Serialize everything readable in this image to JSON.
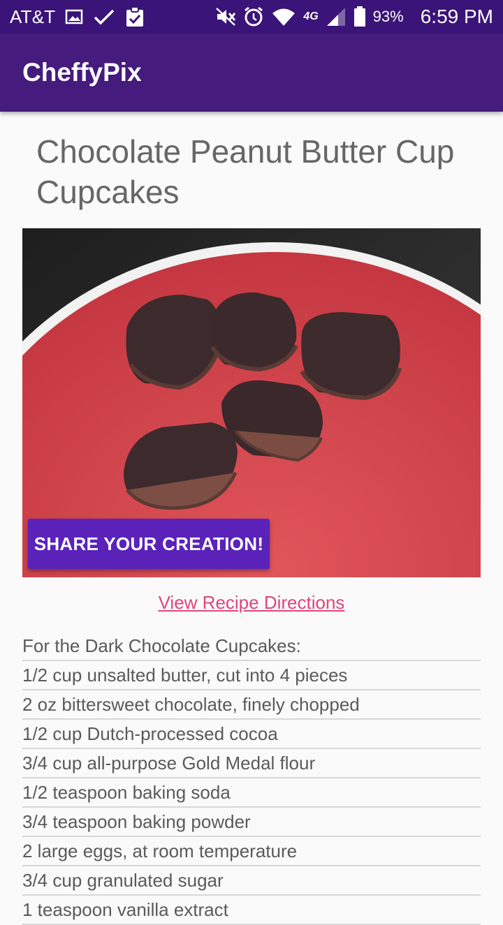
{
  "status_bar": {
    "carrier": "AT&T",
    "network": "4G",
    "battery": "93%",
    "time": "6:59 PM",
    "icons": [
      "gallery-icon",
      "check-icon",
      "clipboard-check-icon",
      "mute-icon",
      "alarm-icon",
      "wifi-icon",
      "signal-icon",
      "battery-icon"
    ]
  },
  "app": {
    "title": "CheffyPix",
    "bar_color": "#451b7e"
  },
  "recipe": {
    "title": "Chocolate Peanut Butter Cup Cupcakes",
    "share_label": "SHARE YOUR CREATION!",
    "directions_link": "View Recipe Directions",
    "ingredients": [
      "For the Dark Chocolate Cupcakes:",
      "1/2 cup unsalted butter, cut into 4 pieces",
      "2 oz bittersweet chocolate, finely chopped",
      "1/2 cup Dutch-processed cocoa",
      "3/4 cup all-purpose Gold Medal flour",
      "1/2 teaspoon baking soda",
      "3/4 teaspoon baking powder",
      "2 large eggs, at room temperature",
      "3/4 cup granulated sugar",
      "1 teaspoon vanilla extract"
    ]
  },
  "colors": {
    "accent": "#5b22ba",
    "link": "#e0457b",
    "status_bar": "#3a1478"
  }
}
